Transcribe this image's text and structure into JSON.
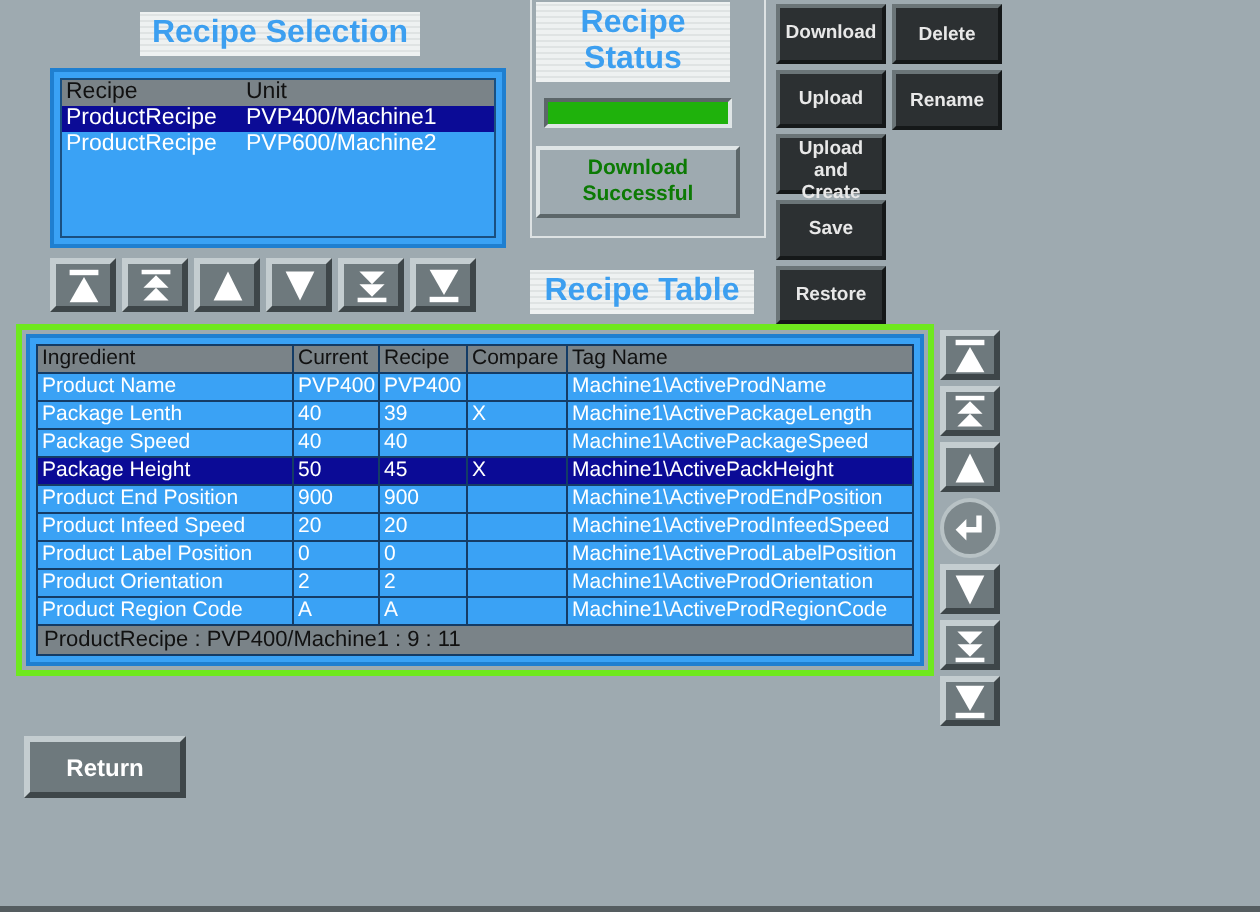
{
  "selection": {
    "title": "Recipe Selection",
    "columns": [
      "Recipe",
      "Unit"
    ],
    "rows": [
      {
        "recipe": "ProductRecipe",
        "unit": "PVP400/Machine1",
        "selected": true
      },
      {
        "recipe": "ProductRecipe",
        "unit": "PVP600/Machine2",
        "selected": false
      }
    ],
    "nav_buttons": [
      {
        "kind": "top"
      },
      {
        "kind": "page-up"
      },
      {
        "kind": "up"
      },
      {
        "kind": "down"
      },
      {
        "kind": "page-down"
      },
      {
        "kind": "bottom"
      }
    ]
  },
  "status": {
    "title": "Recipe Status",
    "level": 1,
    "message": "Download Successful"
  },
  "actions": {
    "main": [
      "Download",
      "Upload",
      "Upload and Create",
      "Save",
      "Restore"
    ],
    "side": [
      "Delete",
      "Rename"
    ]
  },
  "table": {
    "title": "Recipe Table",
    "columns": [
      "Ingredient",
      "Current",
      "Recipe",
      "Compare",
      "Tag Name"
    ],
    "rows": [
      {
        "cells": [
          "Product Name",
          "PVP400",
          "PVP400",
          "",
          "Machine1\\ActiveProdName"
        ],
        "selected": false
      },
      {
        "cells": [
          "Package Lenth",
          "40",
          "39",
          "X",
          "Machine1\\ActivePackageLength"
        ],
        "selected": false
      },
      {
        "cells": [
          "Package Speed",
          "40",
          "40",
          "",
          "Machine1\\ActivePackageSpeed"
        ],
        "selected": false
      },
      {
        "cells": [
          "Package Height",
          "50",
          "45",
          "X",
          "Machine1\\ActivePackHeight"
        ],
        "selected": true
      },
      {
        "cells": [
          "Product End Position",
          "900",
          "900",
          "",
          "Machine1\\ActiveProdEndPosition"
        ],
        "selected": false
      },
      {
        "cells": [
          "Product Infeed Speed",
          "20",
          "20",
          "",
          "Machine1\\ActiveProdInfeedSpeed"
        ],
        "selected": false
      },
      {
        "cells": [
          "Product Label Position",
          "0",
          "0",
          "",
          "Machine1\\ActiveProdLabelPosition"
        ],
        "selected": false
      },
      {
        "cells": [
          "Product Orientation",
          "2",
          "2",
          "",
          "Machine1\\ActiveProdOrientation"
        ],
        "selected": false
      },
      {
        "cells": [
          "Product Region Code",
          "A",
          "A",
          "",
          "Machine1\\ActiveProdRegionCode"
        ],
        "selected": false
      }
    ],
    "footer": "ProductRecipe : PVP400/Machine1 : 9 : 11",
    "nav_buttons": [
      {
        "kind": "top"
      },
      {
        "kind": "page-up"
      },
      {
        "kind": "up"
      },
      {
        "kind": "enter"
      },
      {
        "kind": "down"
      },
      {
        "kind": "page-down"
      },
      {
        "kind": "bottom"
      }
    ]
  },
  "return_button": "Return"
}
